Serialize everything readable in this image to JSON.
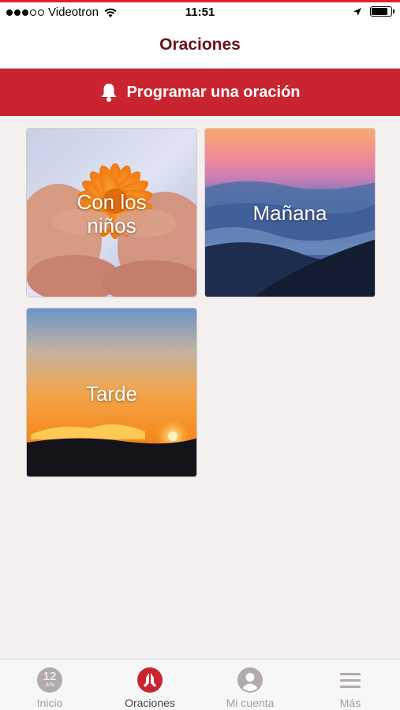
{
  "status_bar": {
    "carrier": "Videotron",
    "time": "11:51",
    "battery_level": 0.85
  },
  "header": {
    "title": "Oraciones"
  },
  "schedule_button": {
    "label": "Programar una oración",
    "icon": "bell-icon"
  },
  "categories": [
    {
      "label_line1": "Con los",
      "label_line2": "niños"
    },
    {
      "label": "Mañana"
    },
    {
      "label": "Tarde"
    }
  ],
  "tab_bar": {
    "tabs": [
      {
        "label": "Inicio",
        "icon": "calendar-icon",
        "day": "12",
        "month": "JUN"
      },
      {
        "label": "Oraciones",
        "icon": "praying-hands-icon"
      },
      {
        "label": "Mi cuenta",
        "icon": "user-icon"
      },
      {
        "label": "Más",
        "icon": "menu-icon"
      }
    ]
  },
  "colors": {
    "accent": "#c9242f",
    "title": "#6a1218",
    "background": "#f4f0ef"
  }
}
